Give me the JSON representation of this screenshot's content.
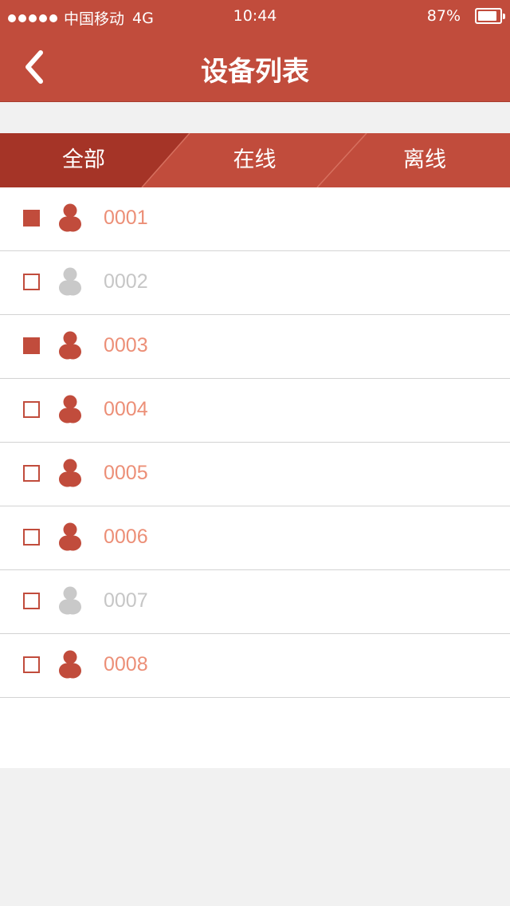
{
  "status": {
    "carrier": "中国移动",
    "network": "4G",
    "time": "10:44",
    "battery": "87%",
    "battery_level": 0.87
  },
  "header": {
    "title": "设备列表",
    "back_icon": "chevron-left-icon"
  },
  "tabs": [
    {
      "label": "全部",
      "active": true
    },
    {
      "label": "在线",
      "active": false
    },
    {
      "label": "离线",
      "active": false
    }
  ],
  "devices": [
    {
      "id": "0001",
      "online": true,
      "checked": true
    },
    {
      "id": "0002",
      "online": false,
      "checked": false
    },
    {
      "id": "0003",
      "online": true,
      "checked": true
    },
    {
      "id": "0004",
      "online": true,
      "checked": false
    },
    {
      "id": "0005",
      "online": true,
      "checked": false
    },
    {
      "id": "0006",
      "online": true,
      "checked": false
    },
    {
      "id": "0007",
      "online": false,
      "checked": false
    },
    {
      "id": "0008",
      "online": true,
      "checked": false
    }
  ],
  "colors": {
    "primary": "#c14c3c",
    "primary_dark": "#a53427",
    "online_text": "#ec8f77",
    "offline_text": "#c6c6c6",
    "offline_icon": "#c9c9c9"
  }
}
